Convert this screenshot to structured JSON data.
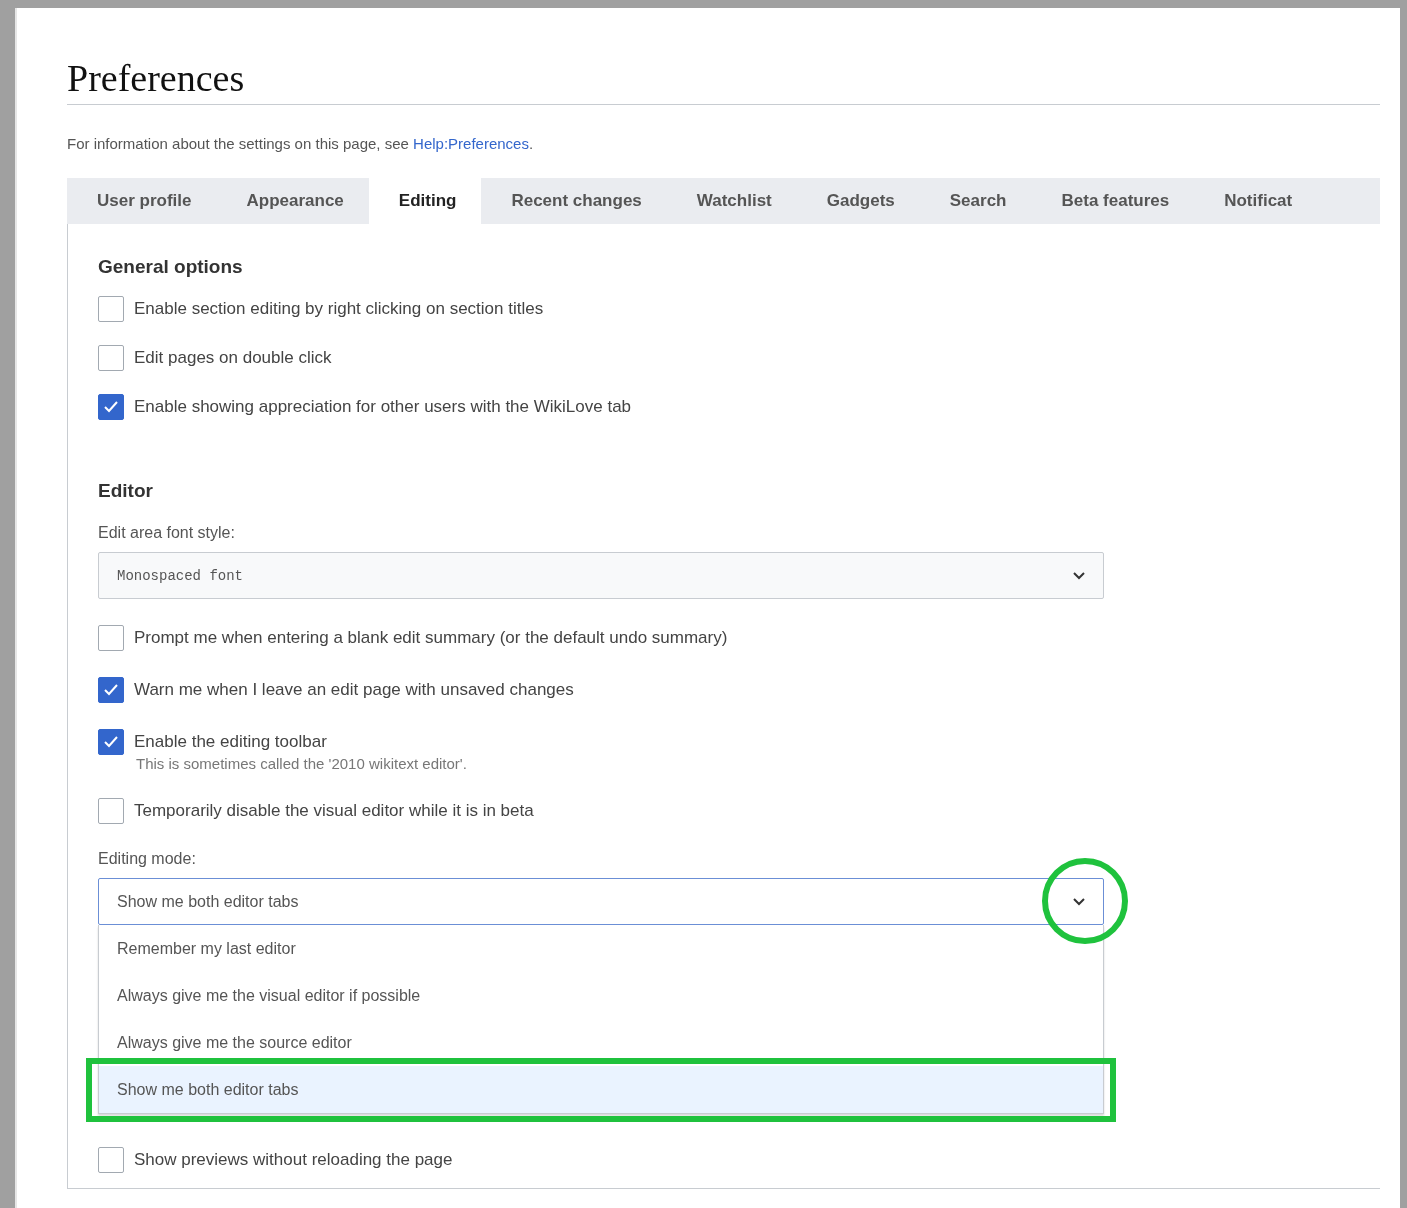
{
  "page": {
    "title": "Preferences",
    "intro": "For information about the settings on this page, see ",
    "link": "Help:Preferences",
    "intro_end": "."
  },
  "tabs": [
    {
      "label": "User profile",
      "selected": false
    },
    {
      "label": "Appearance",
      "selected": false
    },
    {
      "label": "Editing",
      "selected": true
    },
    {
      "label": "Recent changes",
      "selected": false
    },
    {
      "label": "Watchlist",
      "selected": false
    },
    {
      "label": "Gadgets",
      "selected": false
    },
    {
      "label": "Search",
      "selected": false
    },
    {
      "label": "Beta features",
      "selected": false
    },
    {
      "label": "Notificat",
      "selected": false
    }
  ],
  "sections": [
    {
      "heading": "General options",
      "items": [
        {
          "kind": "checkbox",
          "label": "Enable section editing by right clicking on section titles",
          "checked": false
        },
        {
          "kind": "checkbox",
          "label": "Edit pages on double click",
          "checked": false
        },
        {
          "kind": "checkbox",
          "label": "Enable showing appreciation for other users with the WikiLove tab",
          "checked": true
        }
      ]
    },
    {
      "heading": "Editor",
      "items": [
        {
          "kind": "select",
          "label": "Edit area font style:",
          "value": "Monospaced font",
          "expanded": false
        },
        {
          "kind": "checkbox",
          "label": "Prompt me when entering a blank edit summary (or the default undo summary)",
          "checked": false
        },
        {
          "kind": "checkbox",
          "label": "Warn me when I leave an edit page with unsaved changes",
          "checked": true
        },
        {
          "kind": "checkbox",
          "label": "Enable the editing toolbar",
          "hint": "This is sometimes called the '2010 wikitext editor'.",
          "checked": true
        },
        {
          "kind": "checkbox",
          "label": "Temporarily disable the visual editor while it is in beta",
          "checked": false
        },
        {
          "kind": "select",
          "label": "Editing mode:",
          "value": "Show me both editor tabs",
          "expanded": true,
          "caret_circled": true,
          "options": [
            {
              "label": "Remember my last editor",
              "selected": false,
              "framed": false
            },
            {
              "label": "Always give me the visual editor if possible",
              "selected": false,
              "framed": false
            },
            {
              "label": "Always give me the source editor",
              "selected": false,
              "framed": false
            },
            {
              "label": "Show me both editor tabs",
              "selected": true,
              "framed": true
            }
          ]
        },
        {
          "kind": "checkbox",
          "label": "Show previews without reloading the page",
          "checked": false
        }
      ]
    }
  ]
}
